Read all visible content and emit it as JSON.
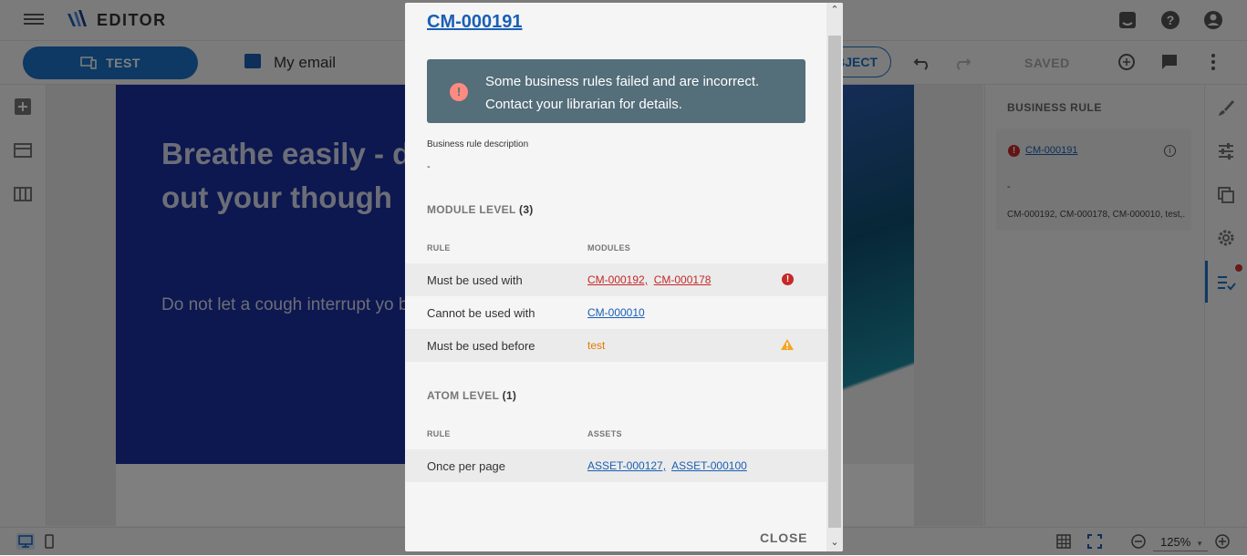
{
  "app": {
    "title": "Editor"
  },
  "toolbar": {
    "test_label": "TEST",
    "email_title": "My email",
    "subject_label": "BJECT",
    "saved_label": "SAVED"
  },
  "email": {
    "headline": "Breathe easily - don't need to co out your though",
    "body": "Do not let a cough interrupt yo breathe easily and do what yo"
  },
  "right_panel": {
    "title": "BUSINESS RULE",
    "card": {
      "link": "CM-000191",
      "dash": "-",
      "modules": "CM-000192, CM-000178, CM-000010, test,..."
    }
  },
  "bottom": {
    "zoom": "125%"
  },
  "modal": {
    "title": "CM-000191",
    "alert": "Some business rules failed and are incorrect. Contact your librarian for details.",
    "desc_label": "Business rule description",
    "desc_value": "-",
    "module_level": {
      "title": "MODULE LEVEL",
      "count": "(3)",
      "col_rule": "RULE",
      "col_modules": "MODULES",
      "rows": [
        {
          "rule": "Must be used with",
          "mod1": "CM-000192,",
          "mod2": "CM-000178",
          "status": "error"
        },
        {
          "rule": "Cannot be used with",
          "mod1": "CM-000010",
          "status": "none"
        },
        {
          "rule": "Must be used before",
          "mod1": "test",
          "status": "warning"
        }
      ]
    },
    "atom_level": {
      "title": "ATOM LEVEL",
      "count": "(1)",
      "col_rule": "RULE",
      "col_assets": "ASSETS",
      "rows": [
        {
          "rule": "Once per page",
          "a1": "ASSET-000127,",
          "a2": "ASSET-000100"
        }
      ]
    },
    "close_label": "CLOSE"
  },
  "colors": {
    "accent": "#1a73c8",
    "error": "#c62828",
    "warning": "#f5a623",
    "alert_bg": "#546e7a"
  },
  "icons": [
    "menu-icon",
    "logo-icon",
    "chat-icon",
    "help-icon",
    "account-icon",
    "device-icon",
    "email-icon",
    "undo-icon",
    "redo-icon",
    "ai-icon",
    "comment-icon",
    "more-icon",
    "add-icon",
    "layout-icon",
    "columns-icon",
    "brush-icon",
    "sliders-icon",
    "copy-icon",
    "gear-icon",
    "checklist-icon",
    "desktop-icon",
    "mobile-icon",
    "grid-icon",
    "fullscreen-icon",
    "zoom-out-icon",
    "zoom-in-icon",
    "error-icon",
    "warning-icon",
    "info-icon"
  ]
}
